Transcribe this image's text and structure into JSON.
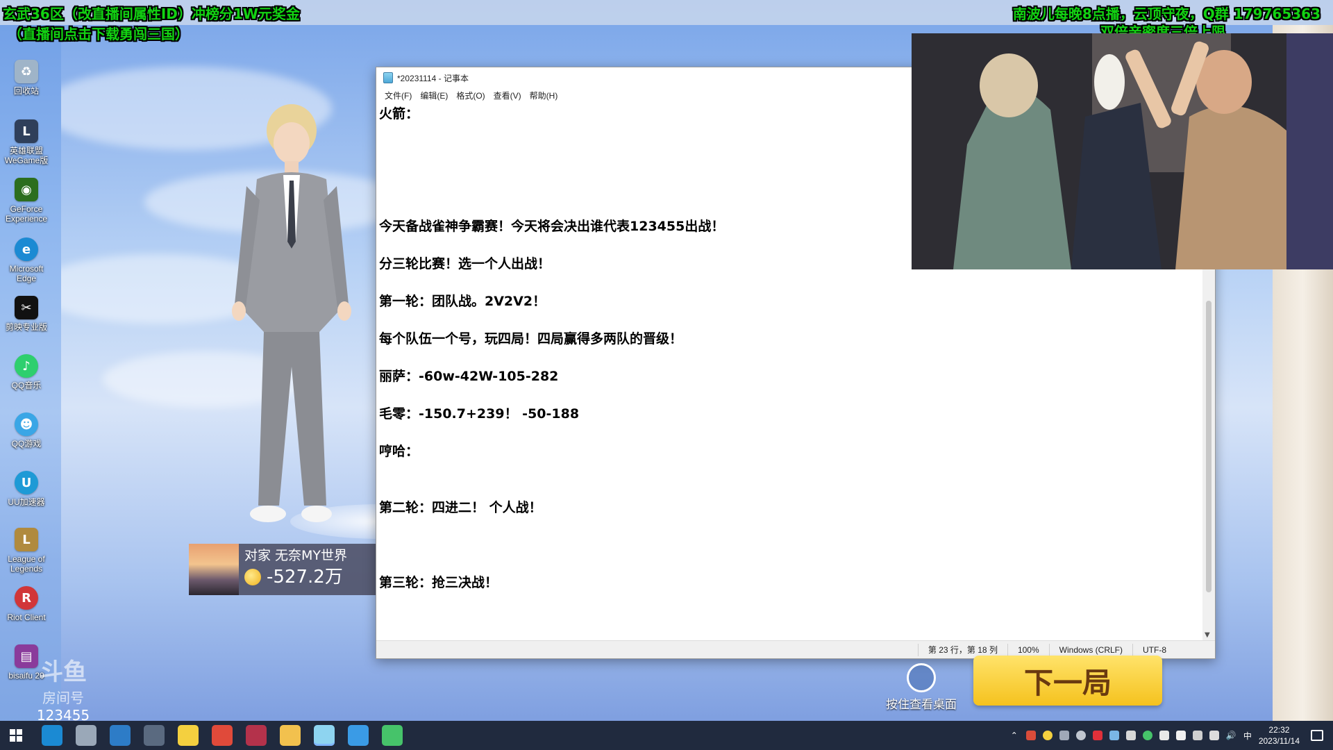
{
  "stream_overlay": {
    "top_left_line1": "玄武36区（改直播间属性ID）冲榜分1W元奖金",
    "top_left_line2": "（直播间点击下载勇闯三国）",
    "top_right_line1": "南波儿每晚8点播，云顶守夜，Q群 179765363",
    "top_right_line2": "双倍亲密度三倍上限",
    "text_color": "#12d212"
  },
  "desktop_icons": [
    {
      "label": "回收站",
      "icon": "recycle-bin-icon",
      "color": "#9fb4c8"
    },
    {
      "label": "英雄联盟\nWeGame版",
      "icon": "league-wegame-icon",
      "color": "#2f3f5a"
    },
    {
      "label": "GeForce\nExperience",
      "icon": "geforce-icon",
      "color": "#2c6e1e"
    },
    {
      "label": "Microsoft\nEdge",
      "icon": "edge-icon",
      "color": "#1b8ad3"
    },
    {
      "label": "剪映专业版",
      "icon": "capcut-icon",
      "color": "#111111"
    },
    {
      "label": "QQ音乐",
      "icon": "qq-music-icon",
      "color": "#2ecf6e"
    },
    {
      "label": "QQ游戏",
      "icon": "qq-game-icon",
      "color": "#3aa6e6"
    },
    {
      "label": "UU加速器",
      "icon": "uu-accelerator-icon",
      "color": "#1e9ad6"
    },
    {
      "label": "League of\nLegends",
      "icon": "league-icon",
      "color": "#b08a3e"
    },
    {
      "label": "Riot Client",
      "icon": "riot-client-icon",
      "color": "#d13639"
    },
    {
      "label": "bisaifu 20",
      "icon": "winrar-icon",
      "color": "#8a3b9b"
    }
  ],
  "opponent": {
    "name": "对家 无奈MY世界",
    "score": "-527.2万"
  },
  "notepad": {
    "title": "*20231114 - 记事本",
    "menu": [
      "文件(F)",
      "编辑(E)",
      "格式(O)",
      "查看(V)",
      "帮助(H)"
    ],
    "lines": [
      {
        "text": "火箭：",
        "row": 0
      },
      {
        "text": "今天备战雀神争霸赛！今天将会决出谁代表123455出战！",
        "row": 6
      },
      {
        "text": "分三轮比赛！选一个人出战！",
        "row": 8
      },
      {
        "text": "第一轮：团队战。2V2V2！",
        "row": 10
      },
      {
        "text": "每个队伍一个号，玩四局！四局赢得多两队的晋级！",
        "row": 12
      },
      {
        "text": "丽萨：-60w-42W-105-282",
        "row": 14
      },
      {
        "text": "毛零：-150.7+239！ -50-188",
        "row": 16
      },
      {
        "text": "哼哈：",
        "row": 18
      },
      {
        "text": "第二轮：四进二！ 个人战！",
        "row": 21
      },
      {
        "text": "第三轮：抢三决战！",
        "row": 25
      }
    ],
    "status": {
      "position": "第 23 行，第 18 列",
      "zoom": "100%",
      "line_ending": "Windows (CRLF)",
      "encoding": "UTF-8"
    }
  },
  "game": {
    "next_round_label": "下一局",
    "fingerprint_label": "按住查看桌面"
  },
  "watermark": {
    "logo": "斗鱼",
    "room_label": "房间号",
    "room_number": "123455"
  },
  "taskbar": {
    "apps": [
      {
        "name": "edge-app",
        "color": "#1b8ad3"
      },
      {
        "name": "bird-app",
        "color": "#9aa8b8"
      },
      {
        "name": "hyperv-app",
        "color": "#2d7cc7"
      },
      {
        "name": "remote-app",
        "color": "#5a6a80"
      },
      {
        "name": "obs-app",
        "color": "#f4d03f"
      },
      {
        "name": "chrome-app",
        "color": "#e04a3a"
      },
      {
        "name": "pen-app",
        "color": "#b4324b"
      },
      {
        "name": "explorer-app",
        "color": "#f2c14e"
      },
      {
        "name": "notepad-app",
        "color": "#8ed4f0"
      },
      {
        "name": "qq-app",
        "color": "#3a9be6"
      },
      {
        "name": "game-app",
        "color": "#46c36a"
      }
    ],
    "input_method": "中",
    "time": "22:32",
    "date": "2023/11/14"
  }
}
